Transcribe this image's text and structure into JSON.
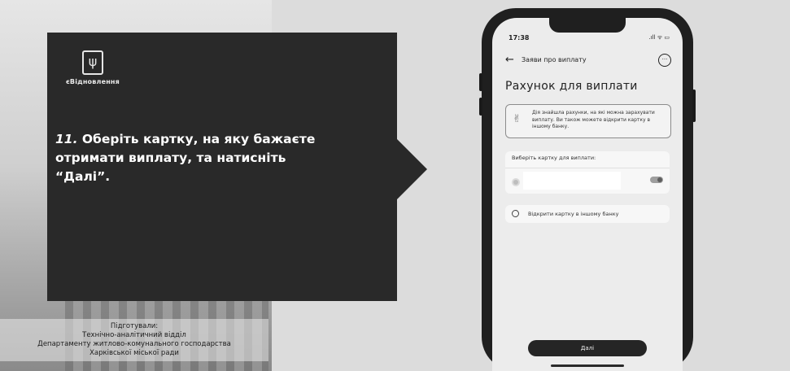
{
  "slide": {
    "logo_text": "єВідновлення",
    "step_number": "11.",
    "step_text": "Оберіть картку, на яку бажаєте отримати виплату, та натисніть “Далі”.",
    "credits": [
      "Підготували:",
      "Технічно-аналітичний відділ",
      "Департаменту житлово-комунального господарства",
      "Харківської міської ради"
    ]
  },
  "phone": {
    "status_time": "17:38",
    "status_icons": ".ıll ᯤ ▭",
    "topbar_title": "Заяви про виплату",
    "screen_title": "Рахунок для виплати",
    "info_text": "Дія знайшла рахунки, на які можна зарахувати виплату. Ви також можете відкрити картку в іншому банку.",
    "card_section_label": "Виберіть картку для виплати:",
    "other_bank_label": "Відкрити картку в іншому банку",
    "next_label": "Далі"
  }
}
